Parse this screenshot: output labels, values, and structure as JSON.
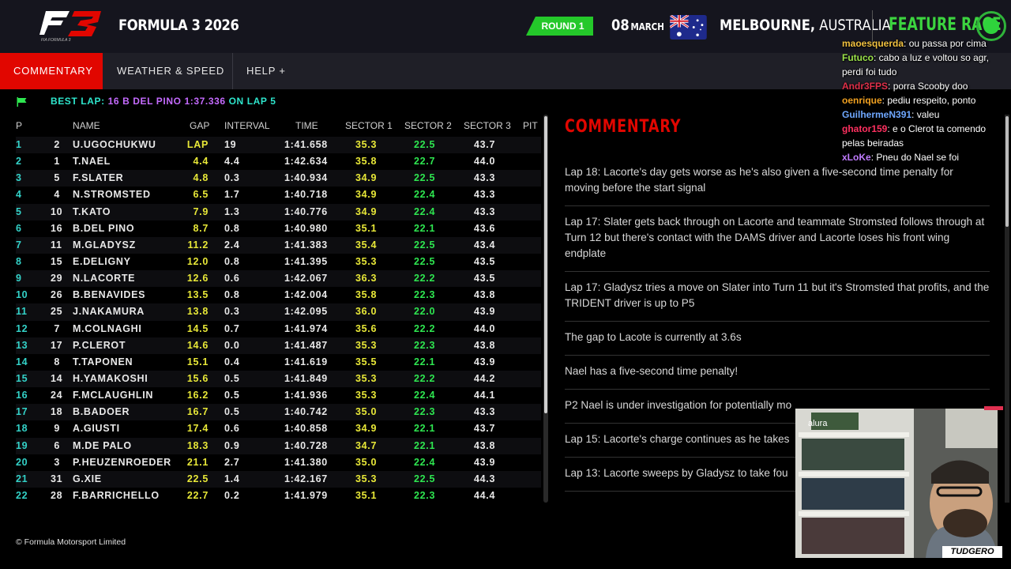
{
  "header": {
    "series": "FORMULA 3 2026",
    "round": "ROUND 1",
    "date_day": "08",
    "date_month": "MARCH",
    "city": "MELBOURNE,",
    "country": "AUSTRALIA",
    "session": "FEATURE RACE",
    "logo_icon": "f3-logo-icon",
    "flag_icon": "australia-flag-icon"
  },
  "tabs": [
    "COMMENTARY",
    "WEATHER & SPEED",
    "HELP +"
  ],
  "best_lap": {
    "label": "BEST LAP:",
    "value": "16 B DEL PINO 1:37.336",
    "on": "ON LAP 5"
  },
  "table": {
    "headers": [
      "P",
      "NAME",
      "GAP",
      "INTERVAL",
      "TIME",
      "SECTOR 1",
      "SECTOR 2",
      "SECTOR 3",
      "PIT"
    ],
    "rows": [
      {
        "p": "1",
        "no": "2",
        "name": "U.UGOCHUKWU",
        "gap": "LAP",
        "int": "19",
        "time": "1:41.658",
        "s1": "35.3",
        "s2": "22.5",
        "s3": "43.7"
      },
      {
        "p": "2",
        "no": "1",
        "name": "T.NAEL",
        "gap": "4.4",
        "int": "4.4",
        "time": "1:42.634",
        "s1": "35.8",
        "s2": "22.7",
        "s3": "44.0"
      },
      {
        "p": "3",
        "no": "5",
        "name": "F.SLATER",
        "gap": "4.8",
        "int": "0.3",
        "time": "1:40.934",
        "s1": "34.9",
        "s2": "22.5",
        "s3": "43.3"
      },
      {
        "p": "4",
        "no": "4",
        "name": "N.STROMSTED",
        "gap": "6.5",
        "int": "1.7",
        "time": "1:40.718",
        "s1": "34.9",
        "s2": "22.4",
        "s3": "43.3"
      },
      {
        "p": "5",
        "no": "10",
        "name": "T.KATO",
        "gap": "7.9",
        "int": "1.3",
        "time": "1:40.776",
        "s1": "34.9",
        "s2": "22.4",
        "s3": "43.3"
      },
      {
        "p": "6",
        "no": "16",
        "name": "B.DEL PINO",
        "gap": "8.7",
        "int": "0.8",
        "time": "1:40.980",
        "s1": "35.1",
        "s2": "22.1",
        "s3": "43.6"
      },
      {
        "p": "7",
        "no": "11",
        "name": "M.GLADYSZ",
        "gap": "11.2",
        "int": "2.4",
        "time": "1:41.383",
        "s1": "35.4",
        "s2": "22.5",
        "s3": "43.4"
      },
      {
        "p": "8",
        "no": "15",
        "name": "E.DELIGNY",
        "gap": "12.0",
        "int": "0.8",
        "time": "1:41.395",
        "s1": "35.3",
        "s2": "22.5",
        "s3": "43.5"
      },
      {
        "p": "9",
        "no": "29",
        "name": "N.LACORTE",
        "gap": "12.6",
        "int": "0.6",
        "time": "1:42.067",
        "s1": "36.3",
        "s2": "22.2",
        "s3": "43.5"
      },
      {
        "p": "10",
        "no": "26",
        "name": "B.BENAVIDES",
        "gap": "13.5",
        "int": "0.8",
        "time": "1:42.004",
        "s1": "35.8",
        "s2": "22.3",
        "s3": "43.8"
      },
      {
        "p": "11",
        "no": "25",
        "name": "J.NAKAMURA",
        "gap": "13.8",
        "int": "0.3",
        "time": "1:42.095",
        "s1": "36.0",
        "s2": "22.0",
        "s3": "43.9"
      },
      {
        "p": "12",
        "no": "7",
        "name": "M.COLNAGHI",
        "gap": "14.5",
        "int": "0.7",
        "time": "1:41.974",
        "s1": "35.6",
        "s2": "22.2",
        "s3": "44.0"
      },
      {
        "p": "13",
        "no": "17",
        "name": "P.CLEROT",
        "gap": "14.6",
        "int": "0.0",
        "time": "1:41.487",
        "s1": "35.3",
        "s2": "22.3",
        "s3": "43.8"
      },
      {
        "p": "14",
        "no": "8",
        "name": "T.TAPONEN",
        "gap": "15.1",
        "int": "0.4",
        "time": "1:41.619",
        "s1": "35.5",
        "s2": "22.1",
        "s3": "43.9"
      },
      {
        "p": "15",
        "no": "14",
        "name": "H.YAMAKOSHI",
        "gap": "15.6",
        "int": "0.5",
        "time": "1:41.849",
        "s1": "35.3",
        "s2": "22.2",
        "s3": "44.2"
      },
      {
        "p": "16",
        "no": "24",
        "name": "F.MCLAUGHLIN",
        "gap": "16.2",
        "int": "0.5",
        "time": "1:41.936",
        "s1": "35.3",
        "s2": "22.4",
        "s3": "44.1"
      },
      {
        "p": "17",
        "no": "18",
        "name": "B.BADOER",
        "gap": "16.7",
        "int": "0.5",
        "time": "1:40.742",
        "s1": "35.0",
        "s2": "22.3",
        "s3": "43.3"
      },
      {
        "p": "18",
        "no": "9",
        "name": "A.GIUSTI",
        "gap": "17.4",
        "int": "0.6",
        "time": "1:40.858",
        "s1": "34.9",
        "s2": "22.1",
        "s3": "43.7"
      },
      {
        "p": "19",
        "no": "6",
        "name": "M.DE PALO",
        "gap": "18.3",
        "int": "0.9",
        "time": "1:40.728",
        "s1": "34.7",
        "s2": "22.1",
        "s3": "43.8"
      },
      {
        "p": "20",
        "no": "3",
        "name": "P.HEUZENROEDER",
        "gap": "21.1",
        "int": "2.7",
        "time": "1:41.380",
        "s1": "35.0",
        "s2": "22.4",
        "s3": "43.9"
      },
      {
        "p": "21",
        "no": "31",
        "name": "G.XIE",
        "gap": "22.5",
        "int": "1.4",
        "time": "1:42.167",
        "s1": "35.3",
        "s2": "22.5",
        "s3": "44.3"
      },
      {
        "p": "22",
        "no": "28",
        "name": "F.BARRICHELLO",
        "gap": "22.7",
        "int": "0.2",
        "time": "1:41.979",
        "s1": "35.1",
        "s2": "22.3",
        "s3": "44.4"
      }
    ]
  },
  "commentary": {
    "title": "COMMENTARY",
    "items": [
      "Lap 18: Lacorte's day gets worse as he's also given a five-second time penalty for moving before the start signal",
      "Lap 17: Slater gets back through on Lacorte and teammate Stromsted follows through at Turn 12 but there's contact with the DAMS driver and Lacorte loses his front wing endplate",
      "Lap 17: Gladysz tries a move on Slater into Turn 11 but it's Stromsted that profits, and the TRIDENT driver is up to P5",
      "The gap to Lacote is currently at 3.6s",
      "Nael has a five-second time penalty!",
      "P2 Nael is under investigation for potentially mo",
      "Lap 15: Lacorte's charge continues as he takes",
      "Lap 13: Lacorte sweeps by Gladysz to take fou"
    ]
  },
  "footer": "© Formula Motorsport Limited",
  "chat": [
    {
      "user": "maoesquerda",
      "text": "ou passa por cima",
      "color": "#f0c040"
    },
    {
      "user": "Futuco",
      "text": "cabo a luz e voltou so agr, perdi foi tudo",
      "color": "#9be34a"
    },
    {
      "user": "Andr3FPS",
      "text": "porra Scooby doo",
      "color": "#e0304a"
    },
    {
      "user": "oenrique",
      "text": "pediu respeito, ponto",
      "color": "#f0a020"
    },
    {
      "user": "GuilhermeN391",
      "text": "valeu",
      "color": "#6fa8ff"
    },
    {
      "user": "ghator159",
      "text": "e o Clerot ta comendo pelas beiradas",
      "color": "#ff3060"
    },
    {
      "user": "xLoKe",
      "text": "Pneu do Nael se foi",
      "color": "#c07cff"
    }
  ],
  "webcam": {
    "overlay_label": "TUDGERO"
  }
}
